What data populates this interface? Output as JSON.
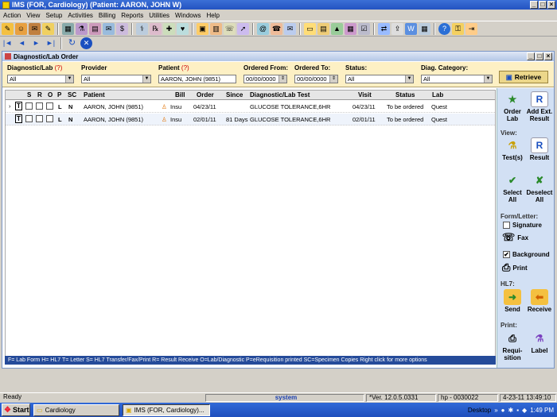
{
  "window": {
    "title": "IMS (FOR, Cardiology)    (Patient: AARON, JOHN W)"
  },
  "menu": [
    "Action",
    "View",
    "Setup",
    "Activities",
    "Billing",
    "Reports",
    "Utilities",
    "Windows",
    "Help"
  ],
  "child": {
    "title": "Diagnostic/Lab Order"
  },
  "filters": {
    "diag_label": "Diagnostic/Lab",
    "diag_q": "(?)",
    "diag_value": "All",
    "provider_label": "Provider",
    "provider_value": "All",
    "patient_label": "Patient",
    "patient_q": "(?)",
    "patient_value": "AARON, JOHN  (9851)",
    "from_label": "Ordered From:",
    "from_value": "00/00/0000",
    "to_label": "Ordered To:",
    "to_value": "00/00/0000",
    "status_label": "Status:",
    "status_value": "All",
    "category_label": "Diag. Category:",
    "category_value": "All",
    "retrieve_label": "Retrieve"
  },
  "grid": {
    "headers": {
      "s": "S",
      "r": "R",
      "o": "O",
      "p": "P",
      "sc": "SC",
      "patient": "Patient",
      "bill": "Bill",
      "order": "Order",
      "since": "Since",
      "test": "Diagnostic/Lab Test",
      "visit": "Visit",
      "status": "Status",
      "lab": "Lab"
    },
    "rows": [
      {
        "t": "T",
        "p": "L",
        "sc": "N",
        "patient": "AARON, JOHN  (9851)",
        "bill": "Insu",
        "order": "04/23/11",
        "since": "",
        "test": "GLUCOSE TOLERANCE,6HR",
        "visit": "04/23/11",
        "status": "To be ordered",
        "lab": "Quest"
      },
      {
        "t": "T",
        "p": "L",
        "sc": "N",
        "patient": "AARON, JOHN  (9851)",
        "bill": "Insu",
        "order": "02/01/11",
        "since": "81 Days",
        "test": "GLUCOSE TOLERANCE,6HR",
        "visit": "02/01/11",
        "status": "To be ordered",
        "lab": "Quest"
      }
    ]
  },
  "legend": "F= Lab Form  H= HL7  T= Letter  S= HL7 Transfer/Fax/Print  R= Result Receive  O=Lab/Diagnostic  P=eRequisition printed  SC=Specimen Copies   Right click for more options",
  "side": {
    "order_lab": "Order Lab",
    "add_ext_result": "Add Ext. Result",
    "view_label": "View:",
    "tests": "Test(s)",
    "result": "Result",
    "select_all": "Select All",
    "deselect_all": "Deselect All",
    "form_label": "Form/Letter:",
    "signature": "Signature",
    "fax": "Fax",
    "background": "Background",
    "print": "Print",
    "hl7_label": "HL7:",
    "send": "Send",
    "receive": "Receive",
    "print_label": "Print:",
    "requisition": "Requi-sition",
    "label": "Label"
  },
  "statusbar": {
    "ready": "Ready",
    "user": "system",
    "version": "*Ver. 12.0.5.0331",
    "machine": "hp - 0030022",
    "datetime": "4-23-11 13:49:10"
  },
  "taskbar": {
    "start": "Start",
    "task1": "Cardiology",
    "task2": "IMS (FOR, Cardiology)...",
    "desktop": "Desktop",
    "time": "1:49 PM"
  }
}
